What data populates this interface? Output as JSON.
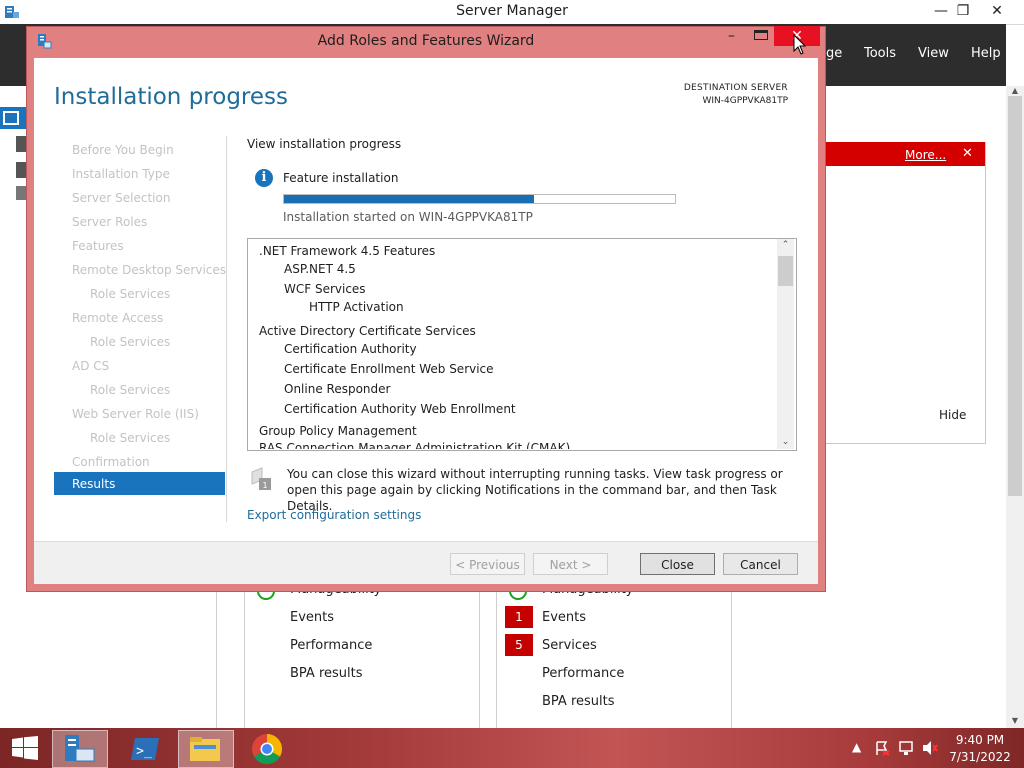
{
  "server_manager": {
    "title": "Server Manager",
    "window_buttons": {
      "minimize": "—",
      "restore": "❐",
      "close": "✕"
    },
    "header_menu": [
      "ge",
      "Tools",
      "View",
      "Help"
    ],
    "notification": {
      "more": "More...",
      "close": "✕",
      "hide": "Hide"
    },
    "tiles": [
      {
        "rows": [
          {
            "label": "Manageability",
            "badge": "",
            "ok": true
          },
          {
            "label": "Events",
            "badge": ""
          },
          {
            "label": "Performance",
            "badge": ""
          },
          {
            "label": "BPA results",
            "badge": ""
          }
        ]
      },
      {
        "rows": [
          {
            "label": "Manageability",
            "badge": "",
            "ok": true
          },
          {
            "label": "Events",
            "badge": "1"
          },
          {
            "label": "Services",
            "badge": "5"
          },
          {
            "label": "Performance",
            "badge": ""
          },
          {
            "label": "BPA results",
            "badge": ""
          }
        ]
      }
    ]
  },
  "wizard": {
    "title": "Add Roles and Features Wizard",
    "heading": "Installation progress",
    "destination_label": "DESTINATION SERVER",
    "destination_value": "WIN-4GPPVKA81TP",
    "steps": [
      {
        "label": "Before You Begin",
        "sub": false
      },
      {
        "label": "Installation Type",
        "sub": false
      },
      {
        "label": "Server Selection",
        "sub": false
      },
      {
        "label": "Server Roles",
        "sub": false
      },
      {
        "label": "Features",
        "sub": false
      },
      {
        "label": "Remote Desktop Services",
        "sub": false
      },
      {
        "label": "Role Services",
        "sub": true
      },
      {
        "label": "Remote Access",
        "sub": false
      },
      {
        "label": "Role Services",
        "sub": true
      },
      {
        "label": "AD CS",
        "sub": false
      },
      {
        "label": "Role Services",
        "sub": true
      },
      {
        "label": "Web Server Role (IIS)",
        "sub": false
      },
      {
        "label": "Role Services",
        "sub": true
      },
      {
        "label": "Confirmation",
        "sub": false
      }
    ],
    "current_step": "Results",
    "view_progress_label": "View installation progress",
    "feature_installation_label": "Feature installation",
    "progress_fraction": 0.64,
    "install_started": "Installation started on WIN-4GPPVKA81TP",
    "results": [
      {
        "text": ".NET Framework 4.5 Features",
        "level": 0
      },
      {
        "text": "ASP.NET 4.5",
        "level": 1
      },
      {
        "text": "WCF Services",
        "level": 1
      },
      {
        "text": "HTTP Activation",
        "level": 2
      },
      {
        "text": "Active Directory Certificate Services",
        "level": 0
      },
      {
        "text": "Certification Authority",
        "level": 1
      },
      {
        "text": "Certificate Enrollment Web Service",
        "level": 1
      },
      {
        "text": "Online Responder",
        "level": 1
      },
      {
        "text": "Certification Authority Web Enrollment",
        "level": 1
      },
      {
        "text": "Group Policy Management",
        "level": 0
      },
      {
        "text": "RAS Connection Manager Administration Kit (CMAK)",
        "level": 0
      }
    ],
    "note": "You can close this wizard without interrupting running tasks. View task progress or open this page again by clicking Notifications in the command bar, and then Task Details.",
    "export_link": "Export configuration settings",
    "buttons": {
      "previous": "< Previous",
      "next": "Next >",
      "close": "Close",
      "cancel": "Cancel"
    }
  },
  "taskbar": {
    "time": "9:40 PM",
    "date": "7/31/2022",
    "apps": [
      "start",
      "server-manager",
      "powershell",
      "file-explorer",
      "chrome"
    ]
  }
}
